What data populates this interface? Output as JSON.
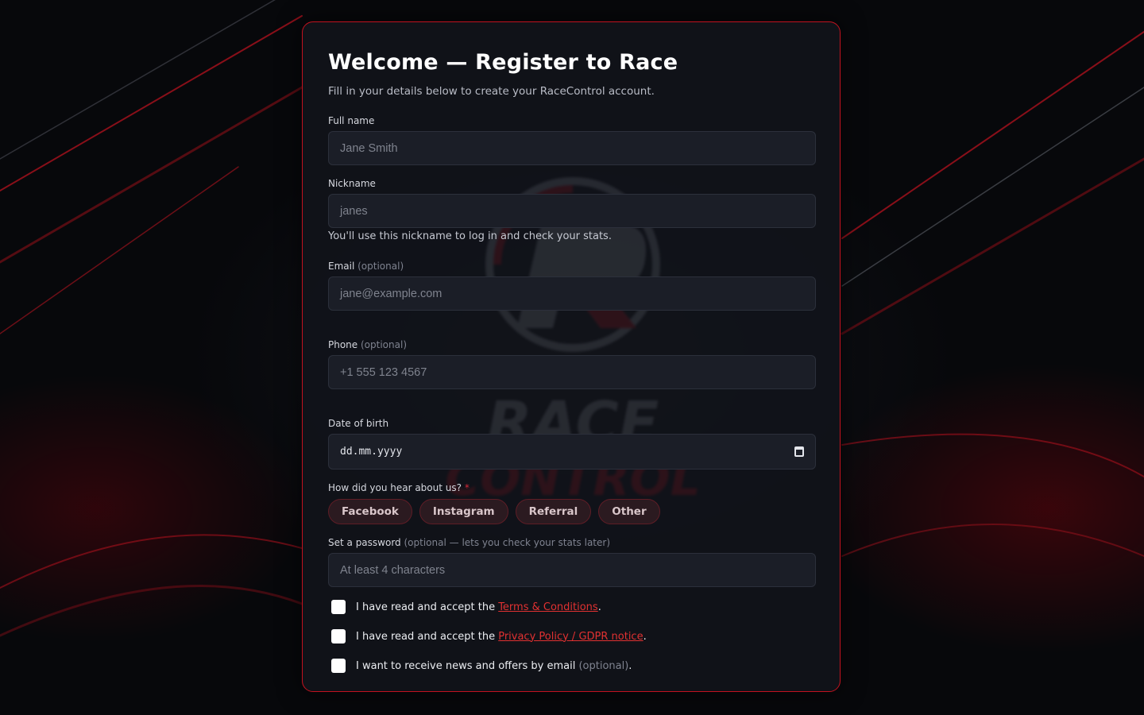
{
  "form": {
    "title": "Welcome — Register to Race",
    "subtitle": "Fill in your details below to create your RaceControl account.",
    "full_name": {
      "label": "Full name",
      "placeholder": "Jane Smith"
    },
    "nickname": {
      "label": "Nickname",
      "placeholder": "janes",
      "hint": "You'll use this nickname to log in and check your stats."
    },
    "email": {
      "label": "Email",
      "optional": "(optional)",
      "placeholder": "jane@example.com"
    },
    "phone": {
      "label": "Phone",
      "optional": "(optional)",
      "placeholder": "+1 555 123 4567"
    },
    "dob": {
      "label": "Date of birth",
      "placeholder": "dd.mm.yyyy",
      "icon": "calendar-icon"
    },
    "source": {
      "label": "How did you hear about us?",
      "required": "*",
      "options": [
        "Facebook",
        "Instagram",
        "Referral",
        "Other"
      ]
    },
    "password": {
      "label": "Set a password",
      "optional": "(optional — lets you check your stats later)",
      "placeholder": "At least 4 characters"
    },
    "consents": [
      {
        "prefix": "I have read and accept the ",
        "link": "Terms & Conditions",
        "suffix": "."
      },
      {
        "prefix": "I have read and accept the ",
        "link": "Privacy Policy / GDPR notice",
        "suffix": "."
      },
      {
        "prefix": "I want to receive news and offers by email ",
        "optional": "(optional)",
        "suffix": "."
      }
    ]
  },
  "watermark": {
    "brand": "RACE CONTROL"
  },
  "colors": {
    "accent": "#c1121f",
    "link": "#e03131",
    "card_bg": "#11131a",
    "input_bg": "#1b1e27"
  }
}
